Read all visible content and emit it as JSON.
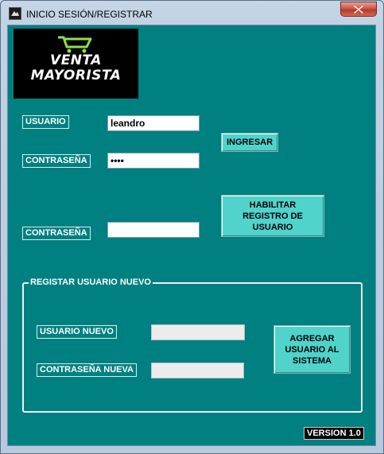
{
  "window": {
    "title": "INICIO SESIÓN/REGISTRAR"
  },
  "logo": {
    "line1": "VENTA",
    "line2": "MAYORISTA"
  },
  "login": {
    "user_label": "USUARIO",
    "user_value": "leandro",
    "password_label": "CONTRASEÑA",
    "password_value": "1234",
    "login_button": "INGRESAR"
  },
  "enable_register": {
    "password_label": "CONTRASEÑA",
    "password_value": "",
    "button_line1": "HABILITAR",
    "button_line2": "REGISTRO DE",
    "button_line3": "USUARIO"
  },
  "register": {
    "group_title": "REGISTAR USUARIO NUEVO",
    "new_user_label": "USUARIO NUEVO",
    "new_user_value": "",
    "new_password_label": "CONTRASEÑA NUEVA",
    "new_password_value": "",
    "button_line1": "AGREGAR",
    "button_line2": "USUARIO AL",
    "button_line3": "SISTEMA"
  },
  "version": "VERSION 1.0",
  "colors": {
    "background": "#008080",
    "button": "#4fd3cb",
    "logo_bg": "#000000",
    "cart": "#8ee04a"
  },
  "icons": {
    "app": "app-icon",
    "close": "close-icon",
    "cart": "shopping-cart-icon"
  }
}
